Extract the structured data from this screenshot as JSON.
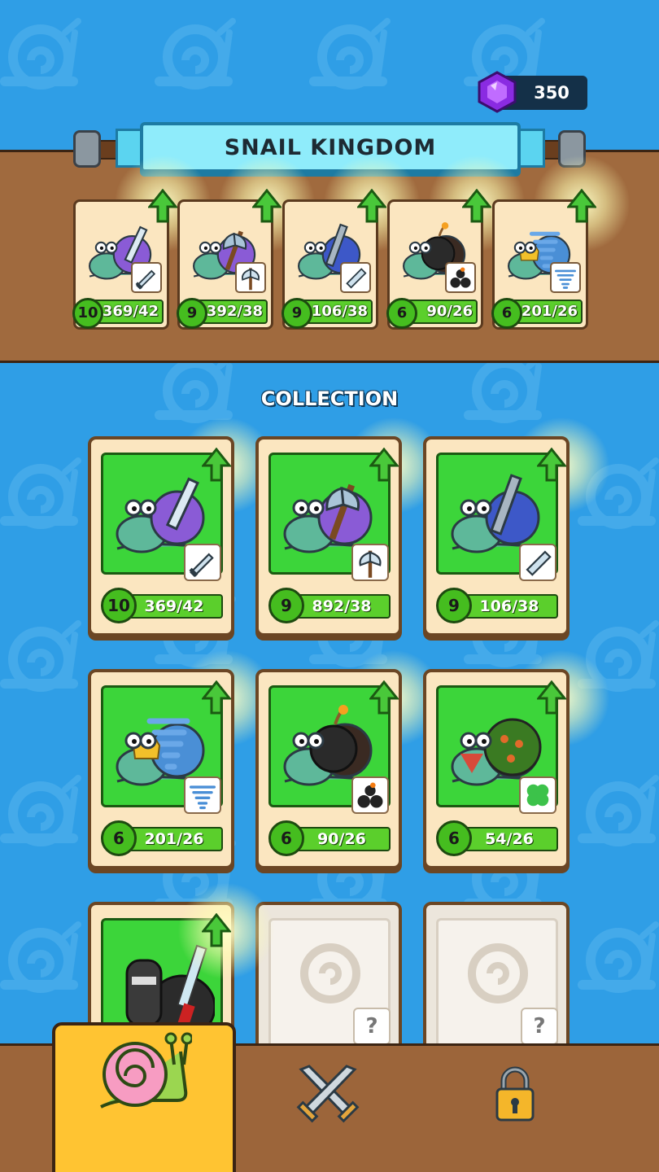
{
  "currency": {
    "gems": "350",
    "icon": "purple-gem-icon"
  },
  "team": {
    "title": "SNAIL KINGDOM",
    "slots": [
      {
        "level": "10",
        "progress": "369/42",
        "weapon": "sword-icon"
      },
      {
        "level": "9",
        "progress": "392/38",
        "weapon": "axe-icon"
      },
      {
        "level": "9",
        "progress": "106/38",
        "weapon": "cannon-icon"
      },
      {
        "level": "6",
        "progress": "90/26",
        "weapon": "bombs-icon"
      },
      {
        "level": "6",
        "progress": "201/26",
        "weapon": "tornado-icon"
      }
    ]
  },
  "collection": {
    "title": "COLLECTION",
    "cards": [
      {
        "level": "10",
        "progress": "369/42",
        "weapon": "sword-icon"
      },
      {
        "level": "9",
        "progress": "892/38",
        "weapon": "axe-icon"
      },
      {
        "level": "9",
        "progress": "106/38",
        "weapon": "cannon-icon"
      },
      {
        "level": "6",
        "progress": "201/26",
        "weapon": "tornado-icon"
      },
      {
        "level": "6",
        "progress": "90/26",
        "weapon": "bombs-icon"
      },
      {
        "level": "6",
        "progress": "54/26",
        "weapon": "clover-icon"
      }
    ],
    "locked_label": "?"
  },
  "nav": {
    "tabs": [
      {
        "name": "snail-tab",
        "icon": "snail-icon",
        "active": true
      },
      {
        "name": "battle-tab",
        "icon": "crossed-swords-icon",
        "active": false
      },
      {
        "name": "locked-tab",
        "icon": "padlock-icon",
        "active": false
      }
    ]
  },
  "colors": {
    "background": "#2f9ee6",
    "panel": "#a06a3e",
    "card_green": "#3cd53a",
    "banner": "#8fecfb",
    "active_tab": "#ffc432"
  }
}
